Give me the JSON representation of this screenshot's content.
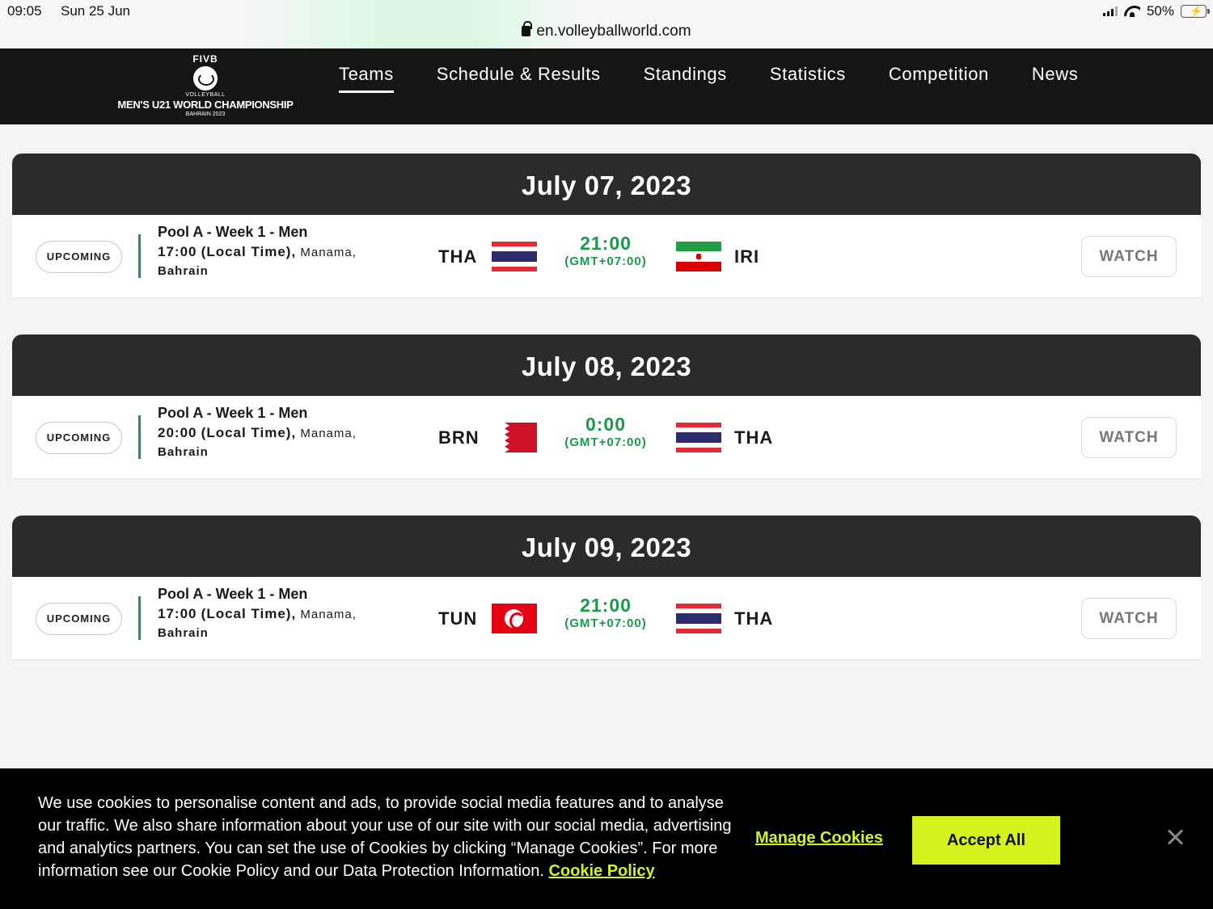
{
  "status_bar": {
    "time": "09:05",
    "date": "Sun 25 Jun",
    "url": "en.volleyballworld.com",
    "battery": "50%",
    "battery_level": 0.5
  },
  "logo": {
    "brand": "FIVB",
    "sub": "VOLLEYBALL",
    "title": "MEN'S U21 WORLD CHAMPIONSHIP",
    "location": "BAHRAIN 2023"
  },
  "nav": {
    "items": [
      "Teams",
      "Schedule & Results",
      "Standings",
      "Statistics",
      "Competition",
      "News"
    ],
    "active": "Teams"
  },
  "days": [
    {
      "date": "July 07, 2023",
      "match": {
        "status": "UPCOMING",
        "pool": "Pool A - Week 1 - Men",
        "local_time": "17:00",
        "local_label": "(Local Time),",
        "city": "Manama,",
        "country": "Bahrain",
        "team_a": "THA",
        "team_a_flag": "thailand-flag",
        "time": "21:00",
        "timezone": "(GMT+07:00)",
        "team_b": "IRI",
        "team_b_flag": "iran-flag",
        "watch": "WATCH"
      }
    },
    {
      "date": "July 08, 2023",
      "match": {
        "status": "UPCOMING",
        "pool": "Pool A - Week 1 - Men",
        "local_time": "20:00",
        "local_label": "(Local Time),",
        "city": "Manama,",
        "country": "Bahrain",
        "team_a": "BRN",
        "team_a_flag": "bahrain-flag",
        "time": "0:00",
        "timezone": "(GMT+07:00)",
        "team_b": "THA",
        "team_b_flag": "thailand-flag",
        "watch": "WATCH"
      }
    },
    {
      "date": "July 09, 2023",
      "match": {
        "status": "UPCOMING",
        "pool": "Pool A - Week 1 - Men",
        "local_time": "17:00",
        "local_label": "(Local Time),",
        "city": "Manama,",
        "country": "Bahrain",
        "team_a": "TUN",
        "team_a_flag": "tunisia-flag",
        "time": "21:00",
        "timezone": "(GMT+07:00)",
        "team_b": "THA",
        "team_b_flag": "thailand-flag",
        "watch": "WATCH"
      }
    }
  ],
  "cookie": {
    "text": "We use cookies to personalise content and ads, to provide social media features and to analyse our traffic. We also share information about your use of our site with our social media, advertising and analytics partners. You can set the use of Cookies by clicking “Manage Cookies”. For more information see our Cookie Policy and our Data Protection Information.",
    "policy_link": "Cookie Policy",
    "manage": "Manage Cookies",
    "accept": "Accept All"
  },
  "colors": {
    "accent_green": "#1a9a4a",
    "cookie_accent": "#d4f21c",
    "nav_bg": "#151515",
    "day_header_bg": "#2b2b2b"
  }
}
